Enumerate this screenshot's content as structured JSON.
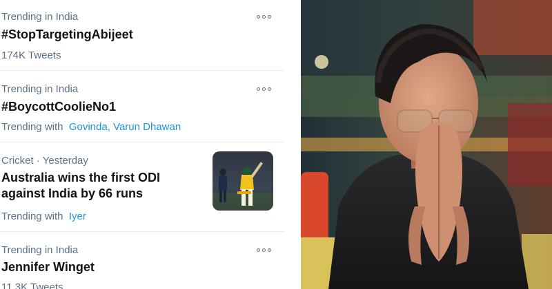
{
  "trends": [
    {
      "meta": "Trending in India",
      "title": "#StopTargetingAbijeet",
      "sub": "174K Tweets",
      "more_icon": "more-horizontal-icon"
    },
    {
      "meta": "Trending in India",
      "title": "#BoycottCoolieNo1",
      "sub_prefix": "Trending with",
      "sub_links": [
        "Govinda",
        "Varun Dhawan"
      ],
      "more_icon": "more-horizontal-icon"
    },
    {
      "meta": "Cricket · Yesterday",
      "title_line1": "Australia wins the first ODI",
      "title_line2": "against India by 66 runs",
      "sub_prefix": "Trending with",
      "sub_links": [
        "Iyer"
      ],
      "thumbnail": "cricket-batsman-thumbnail"
    },
    {
      "meta": "Trending in India",
      "title": "Jennifer Winget",
      "sub": "11.3K Tweets",
      "more_icon": "more-horizontal-icon"
    }
  ],
  "colors": {
    "link": "#1b95e0",
    "meta_text": "#5b7083",
    "title_text": "#0f1419",
    "divider": "#e6ecf0"
  },
  "photo": "man-in-black-shirt-folded-hands-photo"
}
